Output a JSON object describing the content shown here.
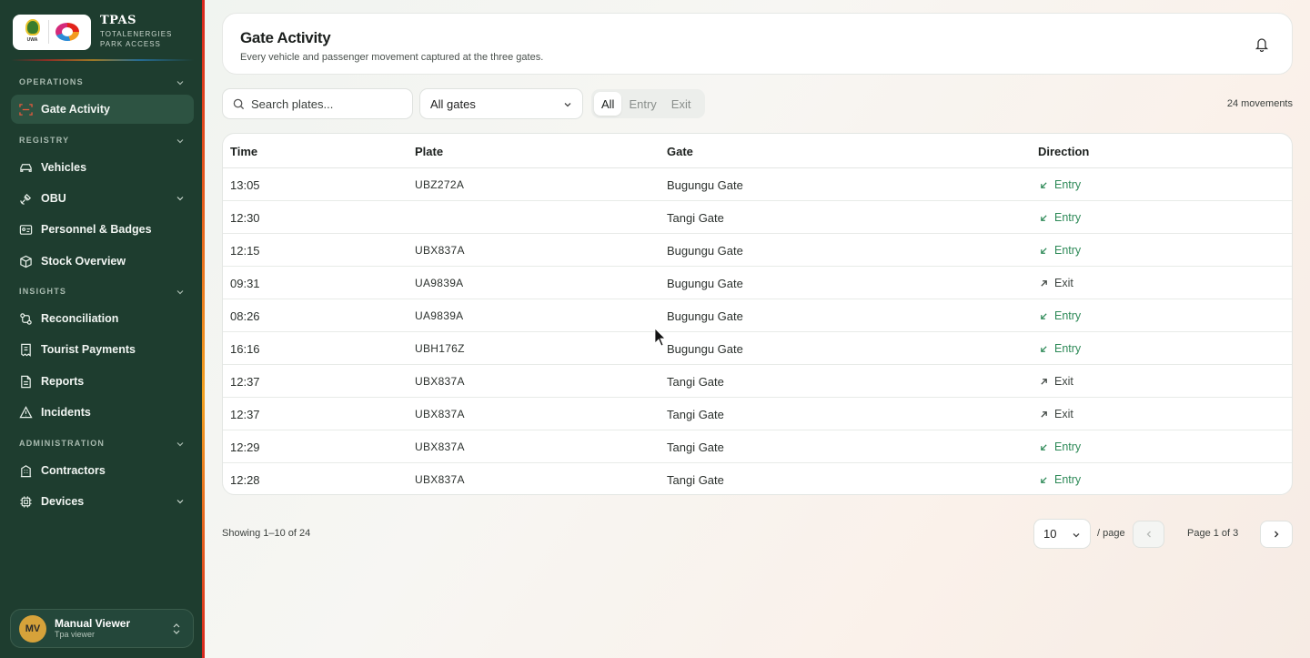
{
  "brand": {
    "title": "TPAS",
    "subtitle_line1": "TOTALENERGIES",
    "subtitle_line2": "PARK ACCESS",
    "logo_uwa_text": "UWA"
  },
  "sidebar": {
    "sections": [
      {
        "label": "OPERATIONS"
      },
      {
        "label": "REGISTRY"
      },
      {
        "label": "INSIGHTS"
      },
      {
        "label": "ADMINISTRATION"
      }
    ],
    "items": [
      {
        "label": "Gate Activity",
        "icon": "scan-icon",
        "active": true
      },
      {
        "label": "Vehicles",
        "icon": "car-icon"
      },
      {
        "label": "OBU",
        "icon": "satellite-icon",
        "expandable": true
      },
      {
        "label": "Personnel & Badges",
        "icon": "id-card-icon"
      },
      {
        "label": "Stock Overview",
        "icon": "box-icon"
      },
      {
        "label": "Reconciliation",
        "icon": "reconcile-icon"
      },
      {
        "label": "Tourist Payments",
        "icon": "receipt-icon"
      },
      {
        "label": "Reports",
        "icon": "file-icon"
      },
      {
        "label": "Incidents",
        "icon": "warning-icon"
      },
      {
        "label": "Contractors",
        "icon": "building-icon"
      },
      {
        "label": "Devices",
        "icon": "chip-icon",
        "expandable": true
      }
    ],
    "user": {
      "initials": "MV",
      "name": "Manual Viewer",
      "role": "Tpa viewer"
    }
  },
  "header": {
    "title": "Gate Activity",
    "subtitle": "Every vehicle and passenger movement captured at the three gates."
  },
  "filters": {
    "search_placeholder": "Search plates...",
    "gate_select": "All gates",
    "direction_options": [
      "All",
      "Entry",
      "Exit"
    ],
    "direction_selected": "All",
    "count_text": "24 movements"
  },
  "table": {
    "columns": [
      "Time",
      "Plate",
      "Gate",
      "Direction"
    ],
    "rows": [
      {
        "time": "13:05",
        "plate": "UBZ272A",
        "gate": "Bugungu Gate",
        "direction": "Entry"
      },
      {
        "time": "12:30",
        "plate": "",
        "gate": "Tangi Gate",
        "direction": "Entry"
      },
      {
        "time": "12:15",
        "plate": "UBX837A",
        "gate": "Bugungu Gate",
        "direction": "Entry"
      },
      {
        "time": "09:31",
        "plate": "UA9839A",
        "gate": "Bugungu Gate",
        "direction": "Exit"
      },
      {
        "time": "08:26",
        "plate": "UA9839A",
        "gate": "Bugungu Gate",
        "direction": "Entry"
      },
      {
        "time": "16:16",
        "plate": "UBH176Z",
        "gate": "Bugungu Gate",
        "direction": "Entry"
      },
      {
        "time": "12:37",
        "plate": "UBX837A",
        "gate": "Tangi Gate",
        "direction": "Exit"
      },
      {
        "time": "12:37",
        "plate": "UBX837A",
        "gate": "Tangi Gate",
        "direction": "Exit"
      },
      {
        "time": "12:29",
        "plate": "UBX837A",
        "gate": "Tangi Gate",
        "direction": "Entry"
      },
      {
        "time": "12:28",
        "plate": "UBX837A",
        "gate": "Tangi Gate",
        "direction": "Entry"
      }
    ]
  },
  "pagination": {
    "showing_text": "Showing 1–10 of 24",
    "page_size": "10",
    "per_page_label": "/ page",
    "page_label": "Page 1 of 3"
  },
  "colors": {
    "sidebar_bg": "#1e3d2f",
    "entry": "#2e8a58",
    "exit": "#3d4440"
  }
}
